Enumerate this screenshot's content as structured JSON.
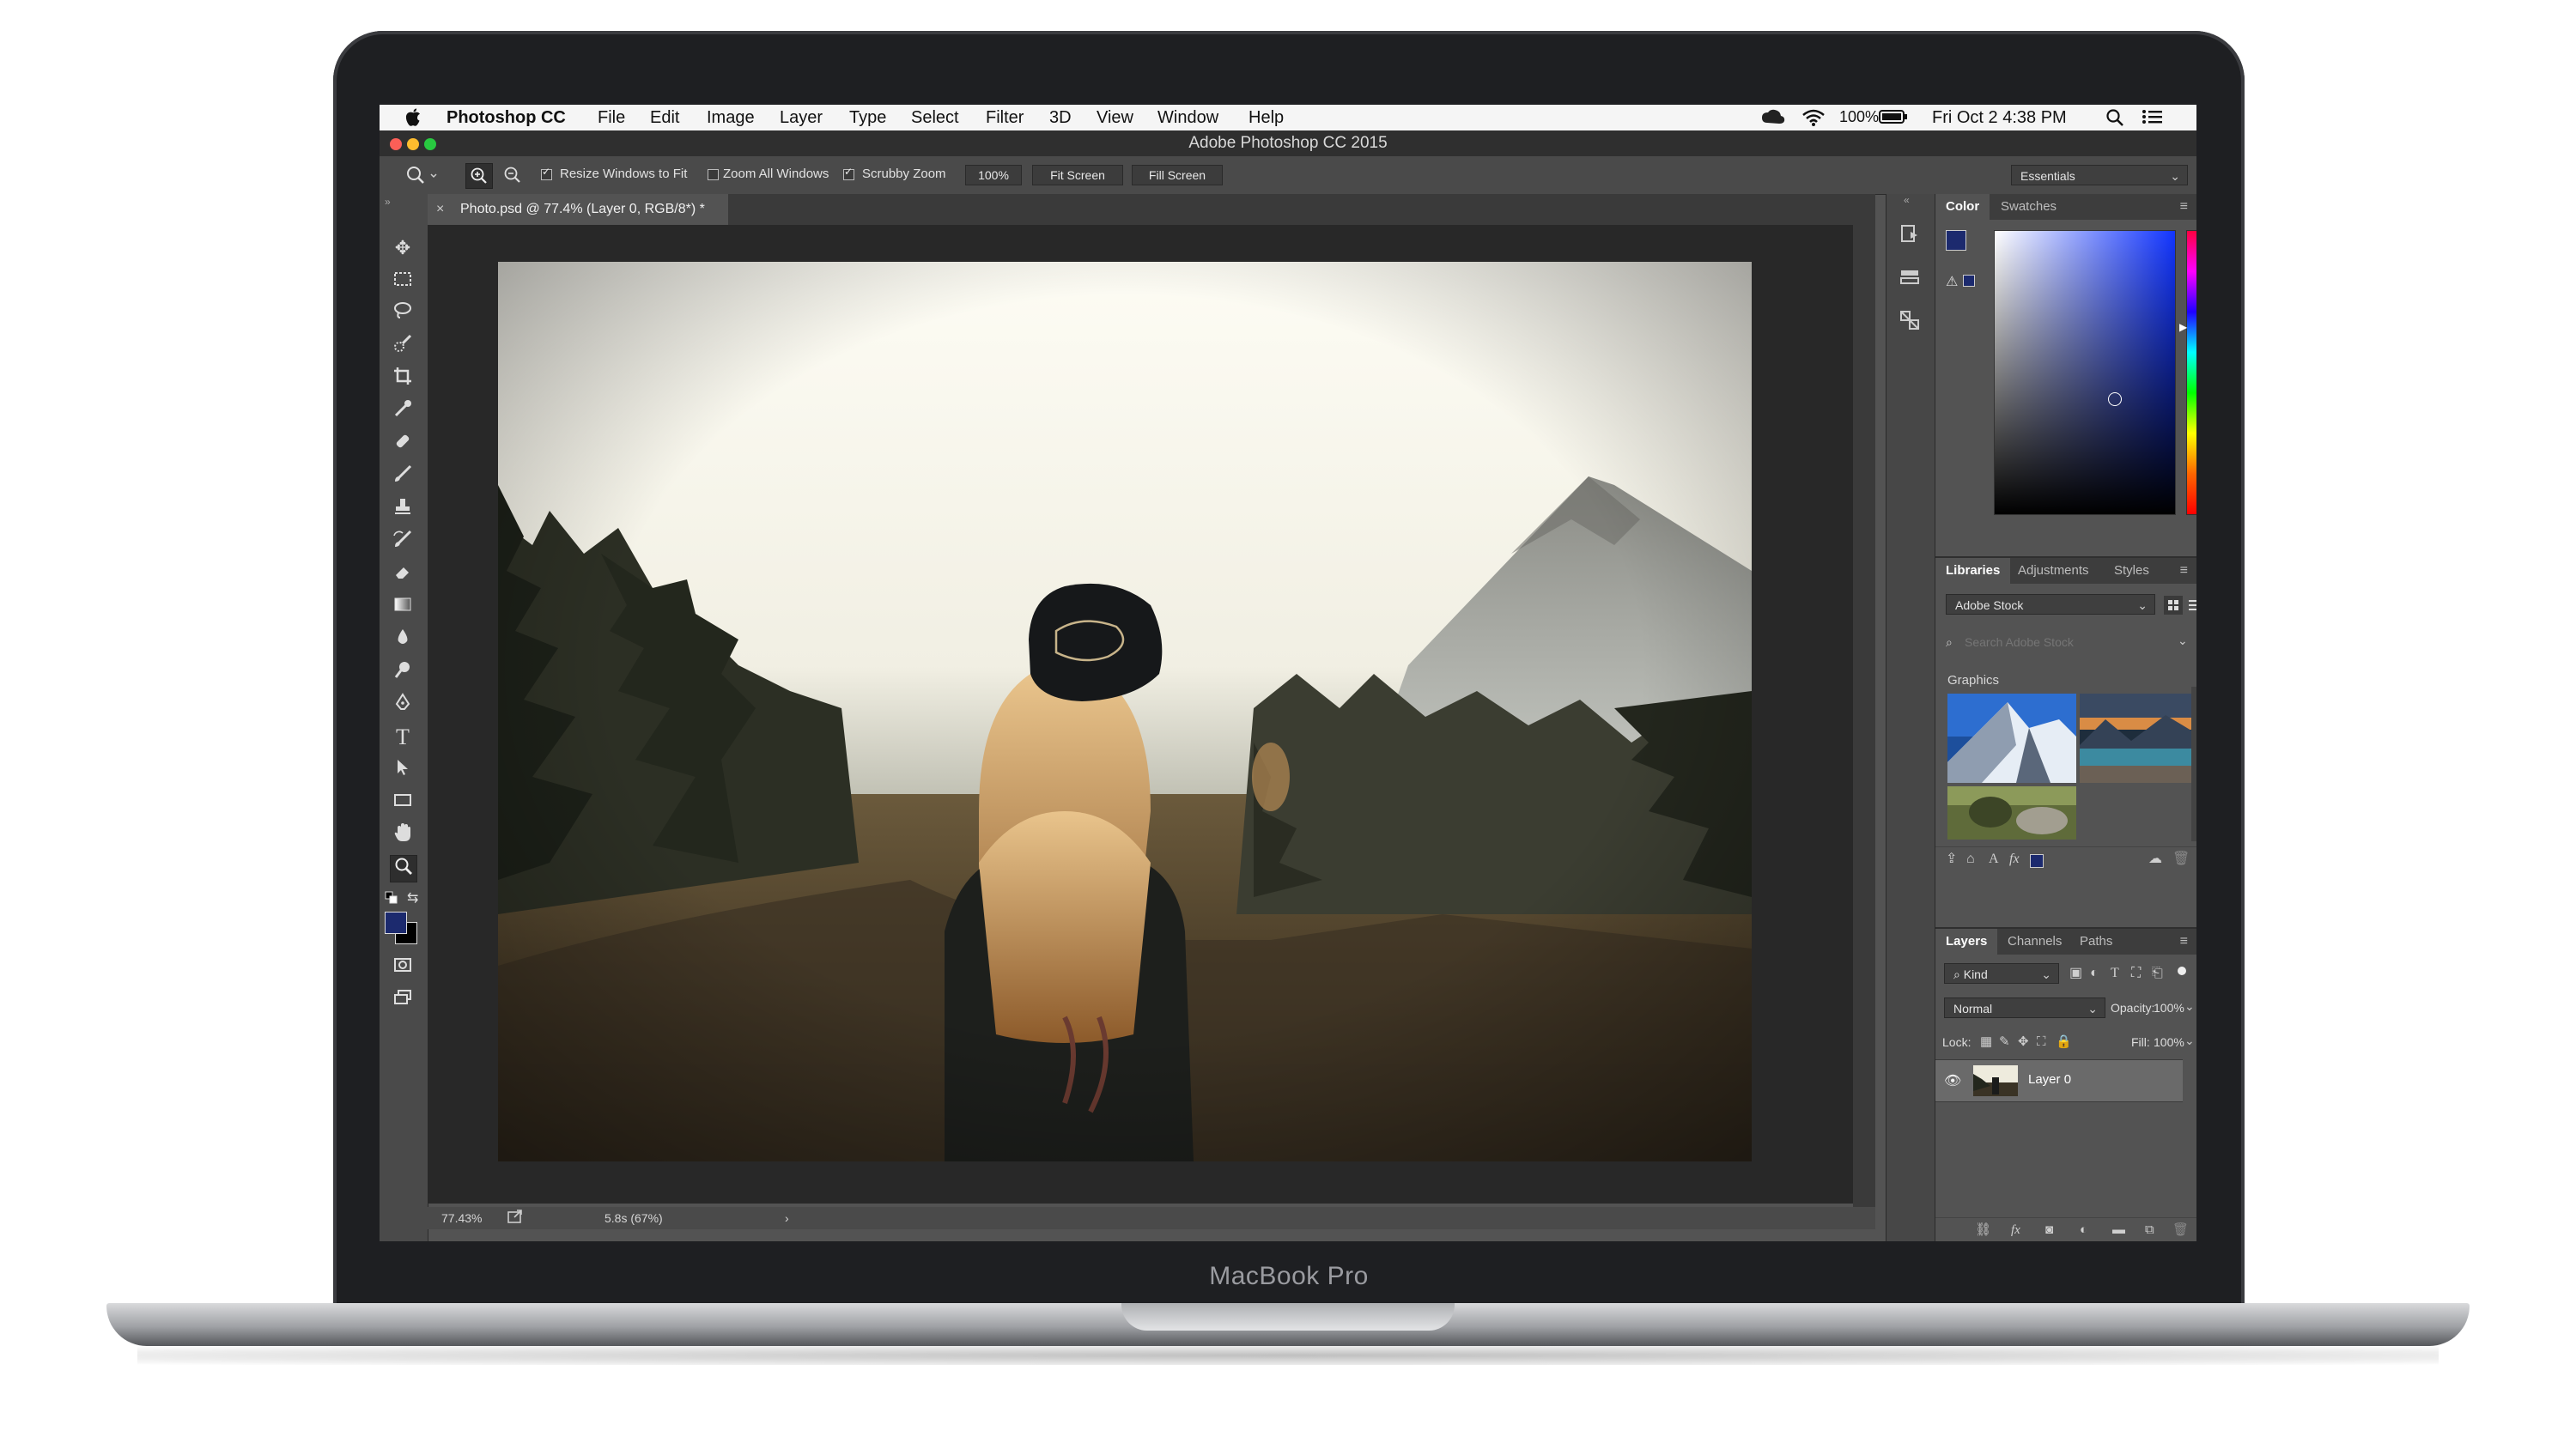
{
  "device": {
    "label": "MacBook Pro"
  },
  "menubar": {
    "apple_icon": "apple-icon",
    "app_name": "Photoshop CC",
    "items": [
      "File",
      "Edit",
      "Image",
      "Layer",
      "Type",
      "Select",
      "Filter",
      "3D",
      "View",
      "Window",
      "Help"
    ],
    "battery": "100%",
    "clock": "Fri Oct 2  4:38 PM"
  },
  "window": {
    "title": "Adobe Photoshop CC 2015"
  },
  "options_bar": {
    "resize_windows": "Resize Windows to Fit",
    "zoom_all": "Zoom All Windows",
    "scrubby_zoom": "Scrubby Zoom",
    "zoom_value": "100%",
    "fit_screen": "Fit Screen",
    "fill_screen": "Fill Screen",
    "workspace": "Essentials",
    "resize_checked": true,
    "zoom_all_checked": false,
    "scrubby_checked": true
  },
  "document": {
    "tab_title": "Photo.psd @ 77.4% (Layer 0, RGB/8*) *",
    "status_zoom": "77.43%",
    "status_info": "5.8s (67%)"
  },
  "color_panel": {
    "tabs": [
      "Color",
      "Swatches"
    ],
    "foreground": "#1c2a6e",
    "background": "#000000"
  },
  "libraries_panel": {
    "tabs": [
      "Libraries",
      "Adjustments",
      "Styles"
    ],
    "library": "Adobe Stock",
    "search_placeholder": "Search Adobe Stock",
    "section": "Graphics"
  },
  "layers_panel": {
    "tabs": [
      "Layers",
      "Channels",
      "Paths"
    ],
    "filter": "Kind",
    "blend_mode": "Normal",
    "opacity_label": "Opacity:",
    "opacity": "100%",
    "lock_label": "Lock:",
    "fill_label": "Fill:",
    "fill": "100%",
    "layer_name": "Layer 0"
  }
}
